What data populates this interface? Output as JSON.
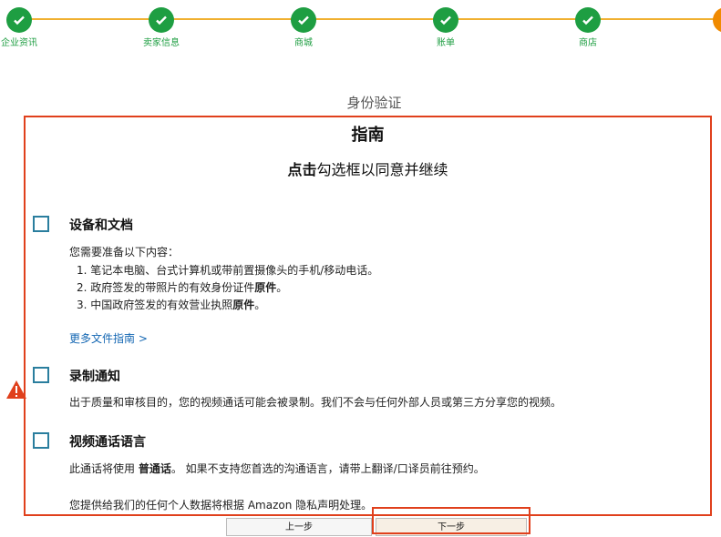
{
  "stepper": {
    "steps": [
      {
        "label": "企业资讯"
      },
      {
        "label": "卖家信息"
      },
      {
        "label": "商城"
      },
      {
        "label": "账单"
      },
      {
        "label": "商店"
      }
    ]
  },
  "section_title": "身份验证",
  "guide": {
    "heading": "指南",
    "subtitle_bold": "点击",
    "subtitle_rest": "勾选框以同意并继续",
    "devices": {
      "title": "设备和文档",
      "intro": "您需要准备以下内容：",
      "item1": "1. 笔记本电脑、台式计算机或带前置摄像头的手机/移动电话。",
      "item2_prefix": "2. 政府签发的带照片的有效身份证件",
      "item2_bold": "原件",
      "item2_suffix": "。",
      "item3_prefix": "3. 中国政府签发的有效营业执照",
      "item3_bold": "原件",
      "item3_suffix": "。",
      "more_link": "更多文件指南 >"
    },
    "recording": {
      "title": "录制通知",
      "text": "出于质量和审核目的，您的视频通话可能会被录制。我们不会与任何外部人员或第三方分享您的视频。"
    },
    "language": {
      "title": "视频通话语言",
      "text_prefix": "此通话将使用 ",
      "text_bold": "普通话",
      "text_suffix": "。 如果不支持您首选的沟通语言，请带上翻译/口译员前往预约。"
    },
    "privacy": "您提供给我们的任何个人数据将根据 Amazon 隐私声明处理。"
  },
  "buttons": {
    "prev": "上一步",
    "next": "下一步"
  },
  "colors": {
    "step_done": "#1e9e42",
    "step_current": "#f08a00",
    "highlight": "#e0401c",
    "link": "#1467b3"
  }
}
